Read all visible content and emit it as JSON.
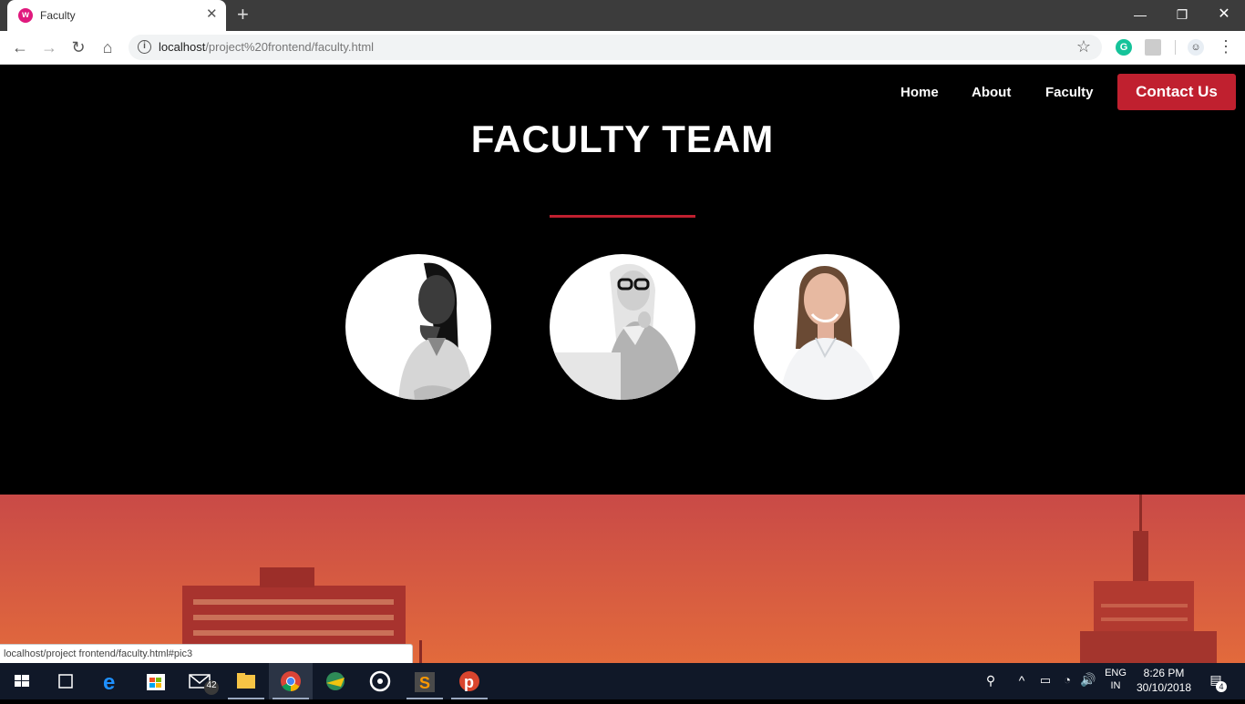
{
  "browser": {
    "tab_title": "Faculty",
    "favicon_letter": "w",
    "url_host": "localhost",
    "url_path": "/project%20frontend/faculty.html"
  },
  "page": {
    "nav": {
      "home": "Home",
      "about": "About",
      "faculty": "Faculty",
      "contact": "Contact Us"
    },
    "heading": "FACULTY TEAM",
    "accent_color": "#c0202f",
    "faculty_members": [
      {
        "photo": "woman-smiling-dark-hair-grayscale"
      },
      {
        "photo": "woman-glasses-blonde-grayscale"
      },
      {
        "photo": "woman-brown-hair-color"
      }
    ]
  },
  "status_url": "localhost/project frontend/faculty.html#pic3",
  "taskbar": {
    "mail_badge": "42",
    "language_1": "ENG",
    "language_2": "IN",
    "time": "8:26 PM",
    "date": "30/10/2018",
    "notification_count": "4"
  }
}
